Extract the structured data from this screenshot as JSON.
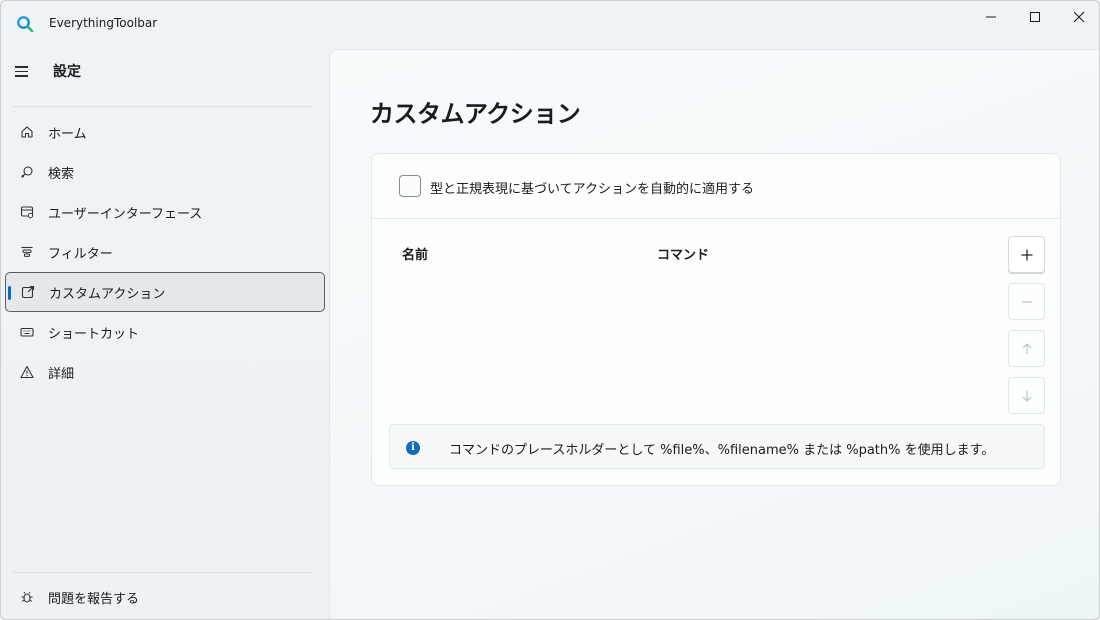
{
  "window": {
    "title": "EverythingToolbar"
  },
  "sidebar": {
    "header": "設定",
    "items": [
      {
        "label": "ホーム",
        "icon": "home-icon"
      },
      {
        "label": "検索",
        "icon": "search-icon"
      },
      {
        "label": "ユーザーインターフェース",
        "icon": "ui-icon"
      },
      {
        "label": "フィルター",
        "icon": "filter-icon"
      },
      {
        "label": "カスタムアクション",
        "icon": "open-external-icon",
        "selected": true
      },
      {
        "label": "ショートカット",
        "icon": "keyboard-icon"
      },
      {
        "label": "詳細",
        "icon": "warning-icon"
      }
    ],
    "footer": {
      "label": "問題を報告する",
      "icon": "bug-icon"
    }
  },
  "main": {
    "title": "カスタムアクション",
    "auto_apply_checkbox": {
      "label": "型と正規表現に基づいてアクションを自動的に適用する",
      "checked": false
    },
    "table": {
      "columns": [
        "名前",
        "コマンド"
      ],
      "rows": []
    },
    "buttons": {
      "add": "+",
      "remove": "−",
      "move_up": "↑",
      "move_down": "↓"
    },
    "info": {
      "icon": "i",
      "text": "コマンドのプレースホルダーとして %file%、%filename% または %path% を使用します。"
    }
  },
  "colors": {
    "accent": "#0f6cbd",
    "background": "#eef3f5"
  }
}
